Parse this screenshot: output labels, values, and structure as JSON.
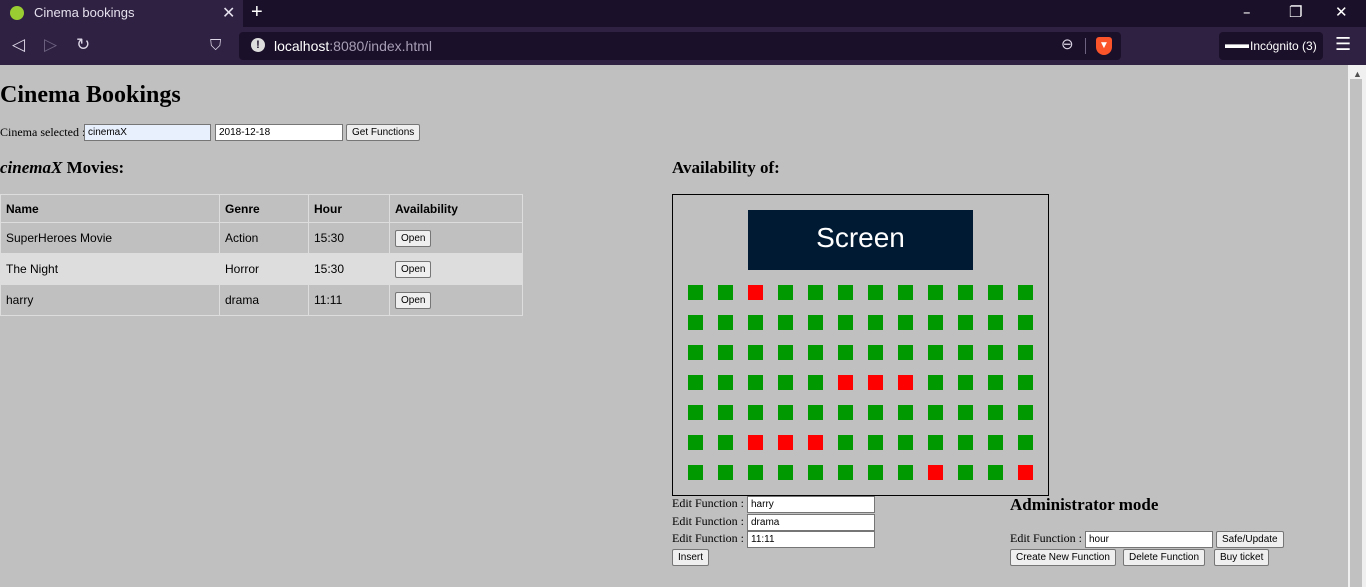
{
  "browser": {
    "tab_title": "Cinema bookings",
    "tab_close": "✕",
    "new_tab": "+",
    "url_host": "localhost",
    "url_path": ":8080/index.html",
    "incognito_label": "Incógnito (3)"
  },
  "page": {
    "title": "Cinema Bookings",
    "cinema_label": "Cinema selected :",
    "cinema_value": "cinemaX",
    "date_value": "2018-12-18",
    "get_functions_label": "Get Functions",
    "movies_heading_cinema": "cinemaX",
    "movies_heading_suffix": " Movies:",
    "availability_heading": "Availability of:",
    "table": {
      "headers": [
        "Name",
        "Genre",
        "Hour",
        "Availability"
      ],
      "rows": [
        {
          "name": "SuperHeroes Movie",
          "genre": "Action",
          "hour": "15:30",
          "button": "Open"
        },
        {
          "name": "The Night",
          "genre": "Horror",
          "hour": "15:30",
          "button": "Open"
        },
        {
          "name": "harry",
          "genre": "drama",
          "hour": "11:11",
          "button": "Open"
        }
      ]
    },
    "screen_label": "Screen",
    "seats": [
      [
        0,
        0,
        1,
        0,
        0,
        0,
        0,
        0,
        0,
        0,
        0,
        0
      ],
      [
        0,
        0,
        0,
        0,
        0,
        0,
        0,
        0,
        0,
        0,
        0,
        0
      ],
      [
        0,
        0,
        0,
        0,
        0,
        0,
        0,
        0,
        0,
        0,
        0,
        0
      ],
      [
        0,
        0,
        0,
        0,
        0,
        1,
        1,
        1,
        0,
        0,
        0,
        0
      ],
      [
        0,
        0,
        0,
        0,
        0,
        0,
        0,
        0,
        0,
        0,
        0,
        0
      ],
      [
        0,
        0,
        1,
        1,
        1,
        0,
        0,
        0,
        0,
        0,
        0,
        0
      ],
      [
        0,
        0,
        0,
        0,
        0,
        0,
        0,
        0,
        1,
        0,
        0,
        1
      ]
    ],
    "seat_colors": {
      "free": "#009900",
      "taken": "#ff0000"
    },
    "edit": {
      "label": "Edit Function :",
      "name_value": "harry",
      "genre_value": "drama",
      "hour_value": "11:11",
      "insert_label": "Insert"
    },
    "admin": {
      "heading": "Administrator mode",
      "label": "Edit Function :",
      "hour_value": "hour",
      "safe_update_label": "Safe/Update",
      "create_label": "Create New Function",
      "delete_label": "Delete Function",
      "buy_label": "Buy ticket"
    }
  }
}
